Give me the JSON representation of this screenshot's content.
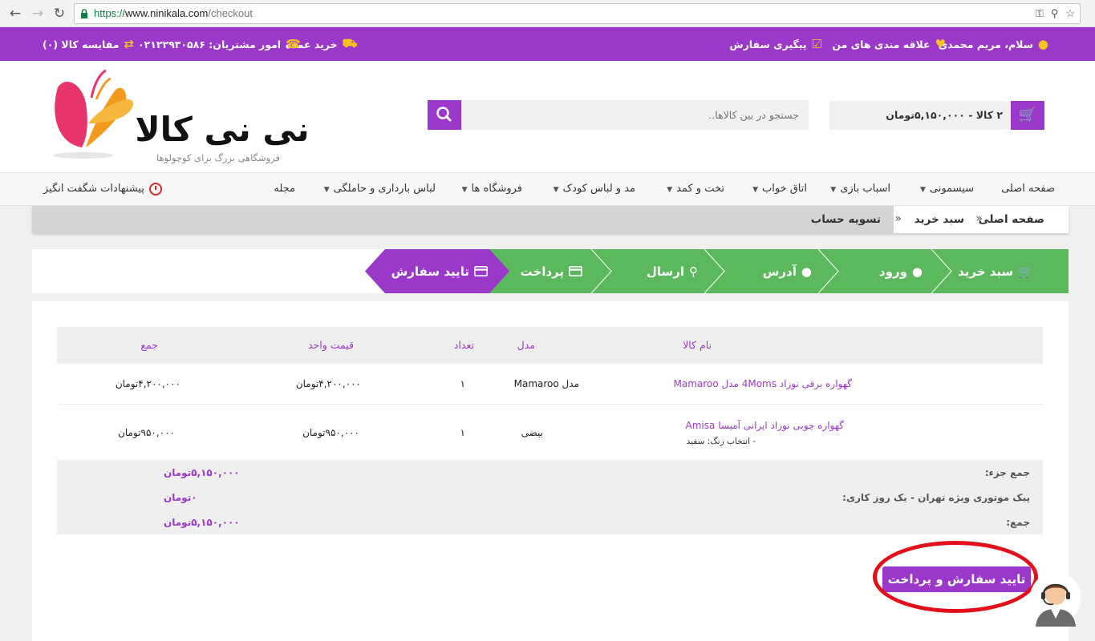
{
  "browser": {
    "url_scheme": "https://",
    "url_host": "www.ninikala.com",
    "url_path": "/checkout"
  },
  "topbar": {
    "greeting": "سلام، مریم محمدی",
    "wishlist": "علاقه مندی های من",
    "track_order": "پیگیری سفارش",
    "wholesale": "خرید عمده",
    "support_phone": "امور مشتریان: ۰۲۱۲۲۹۳۰۵۸۶",
    "compare": "مقایسه کالا (۰)"
  },
  "header": {
    "cart_summary": "۲ کالا - ۵,۱۵۰,۰۰۰تومان",
    "search_placeholder": "جستجو در بین کالاها..",
    "logo_name": "نی نی کالا",
    "logo_tagline": "فروشگاهی بزرگ برای کوچولوها"
  },
  "nav": {
    "home": "صفحه اصلی",
    "sismoni": "سیسمونی",
    "toys": "اسباب بازی",
    "bedroom": "اتاق خواب",
    "bed_closet": "تخت و کمد",
    "fashion": "مد و لباس کودک",
    "stores": "فروشگاه ها",
    "maternity": "لباس بارداری و حاملگی",
    "magazine": "مجله",
    "special_offers": "پیشنهادات شگفت انگیز"
  },
  "breadcrumb": {
    "home": "صفحه اصلی",
    "cart": "سبد خرید",
    "current": "تسویه حساب"
  },
  "steps": [
    {
      "label": "سبد خرید",
      "status": "done"
    },
    {
      "label": "ورود",
      "status": "done"
    },
    {
      "label": "آدرس",
      "status": "done"
    },
    {
      "label": "ارسال",
      "status": "done"
    },
    {
      "label": "پرداخت",
      "status": "done"
    },
    {
      "label": "تایید سفارش",
      "status": "active"
    }
  ],
  "table": {
    "headers": {
      "name": "نام کالا",
      "model": "مدل",
      "qty": "تعداد",
      "unit_price": "قیمت واحد",
      "total": "جمع"
    },
    "rows": [
      {
        "name": "گهواره برقی نوزاد 4Moms مدل Mamaroo",
        "option": "",
        "model": "مدل Mamaroo",
        "qty": "۱",
        "unit_price": "۴,۲۰۰,۰۰۰تومان",
        "total": "۴,۲۰۰,۰۰۰تومان"
      },
      {
        "name": "گهواره چوبی نوزاد ایرانی آمیسا Amisa",
        "option": "- انتخاب رنگ: سفید",
        "model": "بیضی",
        "qty": "۱",
        "unit_price": "۹۵۰,۰۰۰تومان",
        "total": "۹۵۰,۰۰۰تومان"
      }
    ],
    "totals": [
      {
        "label": "جمع جزء:",
        "value": "۵,۱۵۰,۰۰۰تومان"
      },
      {
        "label": "پیک موتوری ویژه تهران - یک روز کاری:",
        "value": "۰تومان"
      },
      {
        "label": "جمع:",
        "value": "۵,۱۵۰,۰۰۰تومان"
      }
    ]
  },
  "confirm_button": "تایید سفارش و پرداخت",
  "colors": {
    "brand_purple": "#9b38c9",
    "step_green": "#5cb85c",
    "accent_yellow": "#f8c21c",
    "highlight_red": "#e2101a"
  }
}
